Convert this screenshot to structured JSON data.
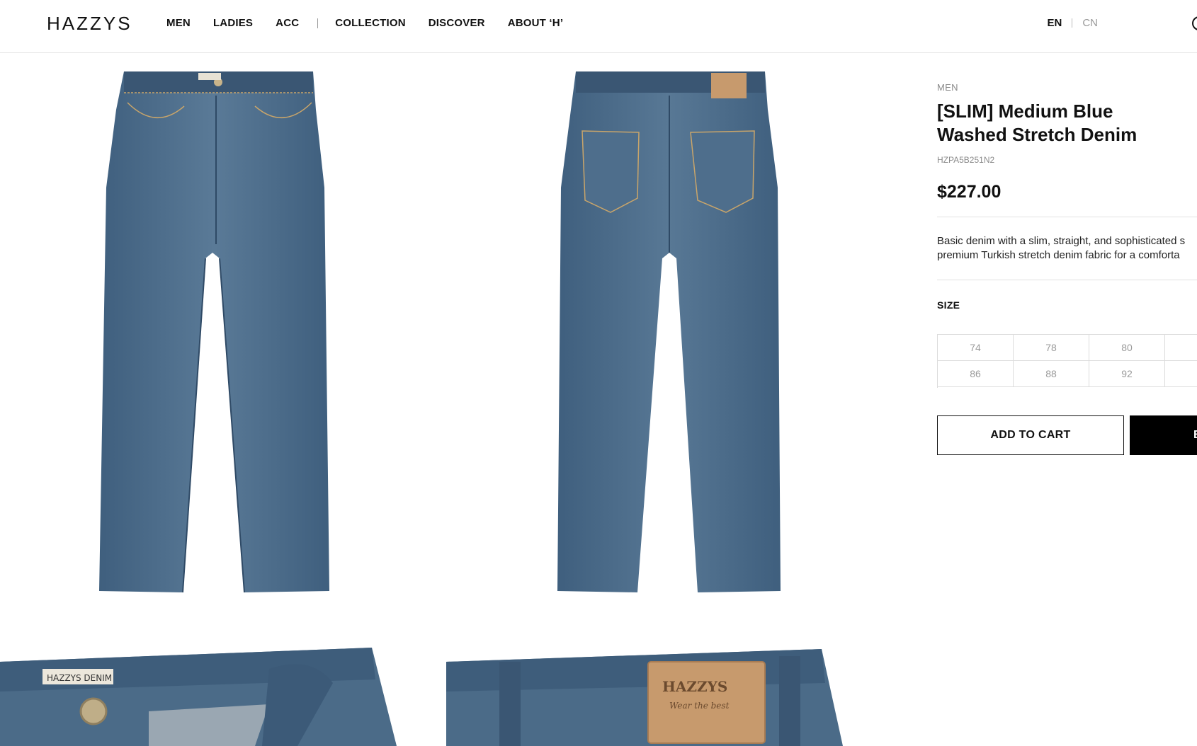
{
  "header": {
    "logo": "HAZZYS",
    "nav": [
      "MEN",
      "LADIES",
      "ACC",
      "COLLECTION",
      "DISCOVER",
      "ABOUT ‘H’"
    ],
    "lang_en": "EN",
    "lang_cn": "CN"
  },
  "product": {
    "category": "MEN",
    "title_line1": "[SLIM] Medium Blue",
    "title_line2": "Washed Stretch Denim",
    "code": "HZPA5B251N2",
    "price": "$227.00",
    "desc_line1": "Basic denim with a slim, straight, and sophisticated s",
    "desc_line2": "premium Turkish stretch denim fabric for a comforta",
    "size_label": "SIZE",
    "sizes": [
      "74",
      "78",
      "80",
      "",
      "86",
      "88",
      "92",
      ""
    ],
    "add_to_cart": "ADD TO CART",
    "buy_now": "B",
    "patch_text": "HAZZYS",
    "patch_script": "Wear the best",
    "front_tag": "HAZZYS DENIM"
  },
  "colors": {
    "denim": "#4a6a88",
    "denim_dark": "#3a5673",
    "patch": "#c79a6d"
  }
}
